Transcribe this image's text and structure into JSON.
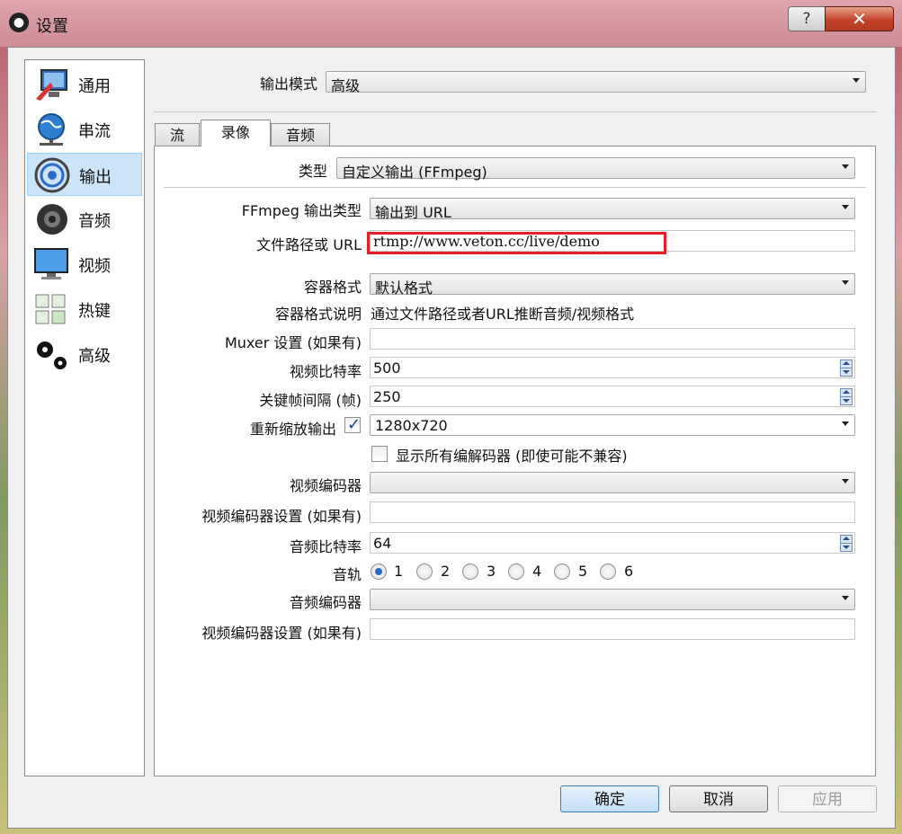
{
  "window": {
    "title": "设置",
    "help_glyph": "?",
    "close_glyph": "✕"
  },
  "sidebar": {
    "items": [
      {
        "label": "通用",
        "icon": "monitor-arrow-icon",
        "selected": false
      },
      {
        "label": "串流",
        "icon": "globe-network-icon",
        "selected": false
      },
      {
        "label": "输出",
        "icon": "broadcast-icon",
        "selected": true
      },
      {
        "label": "音频",
        "icon": "speaker-icon",
        "selected": false
      },
      {
        "label": "视频",
        "icon": "monitor-icon",
        "selected": false
      },
      {
        "label": "热键",
        "icon": "keyboard-icon",
        "selected": false
      },
      {
        "label": "高级",
        "icon": "gears-icon",
        "selected": false
      }
    ]
  },
  "output_mode": {
    "label": "输出模式",
    "value": "高级"
  },
  "tabs": [
    {
      "label": "流",
      "active": false
    },
    {
      "label": "录像",
      "active": true
    },
    {
      "label": "音频",
      "active": false
    }
  ],
  "recording": {
    "type": {
      "label": "类型",
      "value": "自定义输出 (FFmpeg)"
    },
    "ffmpeg_output_type": {
      "label": "FFmpeg 输出类型",
      "value": "输出到 URL"
    },
    "file_path": {
      "label": "文件路径或 URL",
      "value": "rtmp://www.veton.cc/live/demo"
    },
    "container_format": {
      "label": "容器格式",
      "value": "默认格式"
    },
    "container_desc": {
      "label": "容器格式说明",
      "value": "通过文件路径或者URL推断音频/视频格式"
    },
    "muxer_settings": {
      "label": "Muxer 设置 (如果有)",
      "value": ""
    },
    "video_bitrate": {
      "label": "视频比特率",
      "value": "500"
    },
    "keyframe_interval": {
      "label": "关键帧间隔 (帧)",
      "value": "250"
    },
    "rescale_output": {
      "label": "重新缩放输出",
      "checked": true,
      "value": "1280x720"
    },
    "show_all_codecs": {
      "label": "显示所有编解码器 (即使可能不兼容)",
      "checked": false
    },
    "video_encoder": {
      "label": "视频编码器",
      "value": ""
    },
    "video_encoder_settings": {
      "label": "视频编码器设置 (如果有)",
      "value": ""
    },
    "audio_bitrate": {
      "label": "音频比特率",
      "value": "64"
    },
    "audio_track": {
      "label": "音轨",
      "options": [
        "1",
        "2",
        "3",
        "4",
        "5",
        "6"
      ],
      "selected": "1"
    },
    "audio_encoder": {
      "label": "音频编码器",
      "value": ""
    },
    "audio_encoder_settings": {
      "label": "视频编码器设置 (如果有)",
      "value": ""
    }
  },
  "buttons": {
    "ok": "确定",
    "cancel": "取消",
    "apply": "应用"
  },
  "colors": {
    "highlight": "#e0202a",
    "selection": "#cce4f7",
    "close": "#c4432a"
  }
}
